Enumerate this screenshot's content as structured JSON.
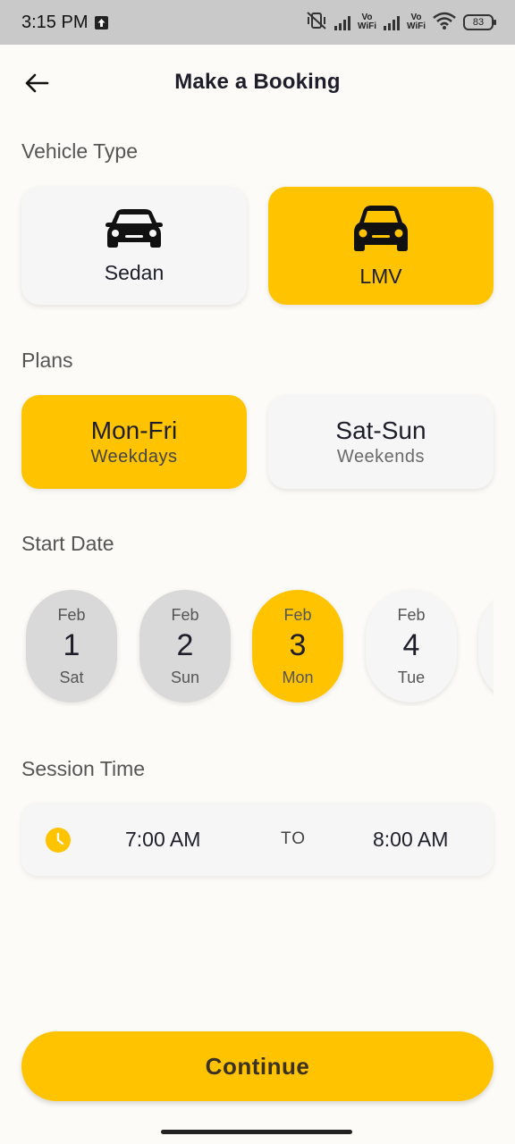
{
  "status_bar": {
    "time": "3:15 PM",
    "vowifi_1": "Vo\nWiFi",
    "vowifi_2": "Vo\nWiFi",
    "battery": "83"
  },
  "header": {
    "title": "Make a Booking"
  },
  "vehicle_type": {
    "label": "Vehicle Type",
    "options": [
      {
        "label": "Sedan",
        "selected": false
      },
      {
        "label": "LMV",
        "selected": true
      }
    ]
  },
  "plans": {
    "label": "Plans",
    "options": [
      {
        "title": "Mon-Fri",
        "subtitle": "Weekdays",
        "selected": true
      },
      {
        "title": "Sat-Sun",
        "subtitle": "Weekends",
        "selected": false
      }
    ]
  },
  "start_date": {
    "label": "Start Date",
    "dates": [
      {
        "month": "Feb",
        "day": "1",
        "weekday": "Sat",
        "state": "past"
      },
      {
        "month": "Feb",
        "day": "2",
        "weekday": "Sun",
        "state": "past"
      },
      {
        "month": "Feb",
        "day": "3",
        "weekday": "Mon",
        "state": "selected"
      },
      {
        "month": "Feb",
        "day": "4",
        "weekday": "Tue",
        "state": "future"
      }
    ]
  },
  "session_time": {
    "label": "Session Time",
    "from": "7:00 AM",
    "to_label": "TO",
    "to": "8:00 AM"
  },
  "continue_label": "Continue",
  "colors": {
    "accent": "#ffc300",
    "card_inactive": "#f6f6f6",
    "date_past": "#d9d9d9",
    "background": "#fdfbf8"
  },
  "icons": {
    "back": "arrow-left-icon",
    "vehicle": "car-icon",
    "clock": "clock-icon"
  }
}
